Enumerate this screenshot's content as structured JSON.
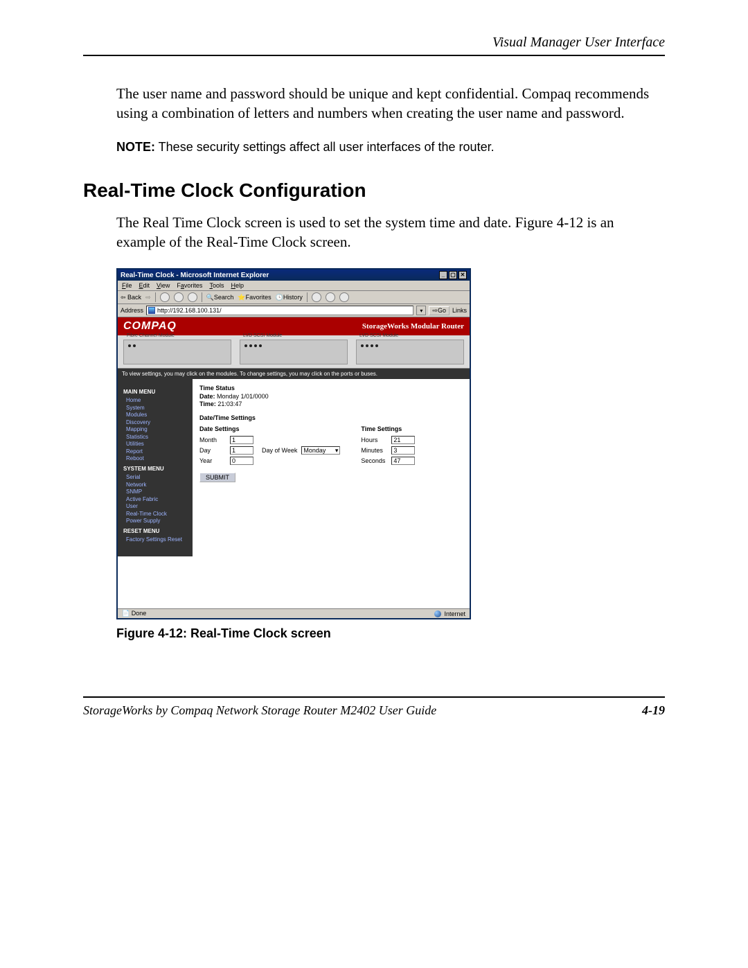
{
  "header": {
    "right": "Visual Manager User Interface"
  },
  "para1": "The user name and password should be unique and kept confidential. Compaq recommends using a combination of letters and numbers when creating the user name and password.",
  "note": {
    "label": "NOTE:",
    "text": " These security settings affect all user interfaces of the router."
  },
  "section_heading": "Real-Time Clock Configuration",
  "para2": "The Real Time Clock screen is used to set the system time and date. Figure 4-12 is an example of the Real-Time Clock screen.",
  "ie": {
    "title": "Real-Time Clock - Microsoft Internet Explorer",
    "menu": {
      "file": "File",
      "edit": "Edit",
      "view": "View",
      "favorites": "Favorites",
      "tools": "Tools",
      "help": "Help"
    },
    "toolbar": {
      "back": "Back",
      "search": "Search",
      "favorites": "Favorites",
      "history": "History"
    },
    "address_label": "Address",
    "url": "http://192.168.100.131/",
    "go": "Go",
    "links": "Links",
    "status_left": "Done",
    "status_right": "Internet"
  },
  "app": {
    "brand": "COMPAQ",
    "subtitle": "StorageWorks Modular Router",
    "modules": {
      "m1": "Fibre Channel Module",
      "m2": "LVD SCSI Module",
      "m3": "LVD SCSI Module"
    },
    "hint": "To view settings, you may click on the modules. To change settings, you may click on the ports or buses.",
    "menus": {
      "main_head": "MAIN MENU",
      "main": [
        "Home",
        "System",
        "Modules",
        "Discovery",
        "Mapping",
        "Statistics",
        "Utilities",
        "Report",
        "Reboot"
      ],
      "sys_head": "SYSTEM MENU",
      "sys": [
        "Serial",
        "Network",
        "SNMP",
        "Active Fabric",
        "User",
        "Real-Time Clock",
        "Power Supply"
      ],
      "reset_head": "RESET MENU",
      "reset": [
        "Factory Settings Reset"
      ]
    },
    "panel": {
      "time_status_head": "Time Status",
      "date_label": "Date:",
      "date_value": "Monday 1/01/0000",
      "time_label": "Time:",
      "time_value": "21:03:47",
      "dts_head": "Date/Time Settings",
      "date_col_head": "Date Settings",
      "time_col_head": "Time Settings",
      "month_label": "Month",
      "month_value": "1",
      "day_label": "Day",
      "day_value": "1",
      "dow_label": "Day of Week",
      "dow_value": "Monday",
      "year_label": "Year",
      "year_value": "0",
      "hours_label": "Hours",
      "hours_value": "21",
      "minutes_label": "Minutes",
      "minutes_value": "3",
      "seconds_label": "Seconds",
      "seconds_value": "47",
      "submit": "SUBMIT"
    }
  },
  "caption": "Figure 4-12:  Real-Time Clock screen",
  "footer": {
    "left": "StorageWorks by Compaq Network Storage Router M2402 User Guide",
    "right": "4-19"
  }
}
